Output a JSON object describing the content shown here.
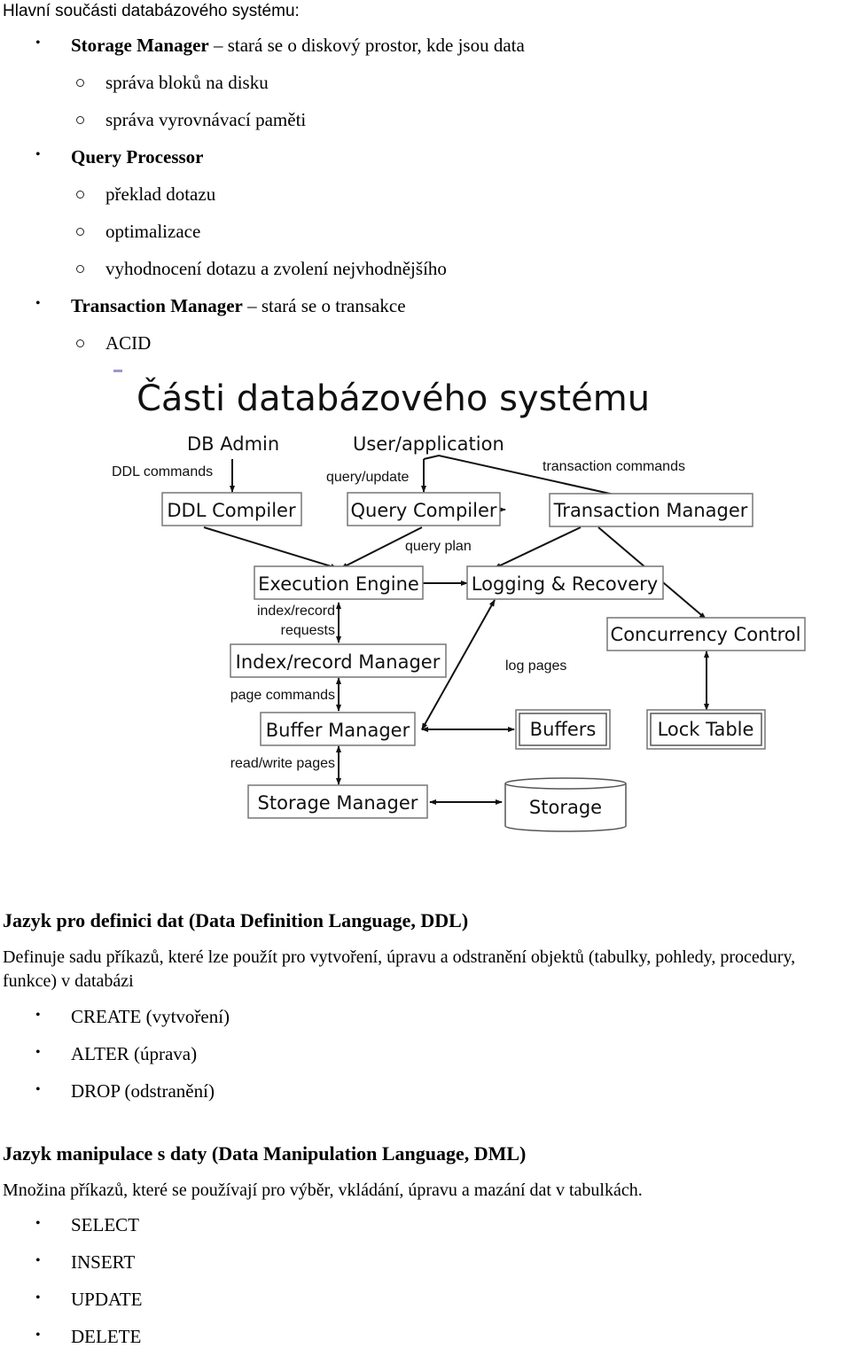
{
  "intro": "Hlavní součásti databázového systému:",
  "components": [
    {
      "name": "Storage Manager",
      "desc": " – stará se o diskový prostor, kde jsou data",
      "sub": [
        "správa bloků na disku",
        "správa vyrovnávací paměti"
      ]
    },
    {
      "name": "Query Processor",
      "desc": "",
      "sub": [
        "překlad dotazu",
        "optimalizace",
        "vyhodnocení dotazu a zvolení nejvhodnějšího"
      ]
    },
    {
      "name": "Transaction Manager",
      "desc": " – stará se o transakce",
      "sub": [
        "ACID"
      ]
    }
  ],
  "diagram": {
    "title": "Části databázového systému",
    "actors": {
      "db_admin": "DB Admin",
      "user_app": "User/application"
    },
    "boxes": {
      "ddl_compiler": "DDL Compiler",
      "query_compiler": "Query Compiler",
      "transaction_manager": "Transaction Manager",
      "execution_engine": "Execution Engine",
      "logging_recovery": "Logging & Recovery",
      "concurrency_control": "Concurrency Control",
      "index_record_manager": "Index/record Manager",
      "buffer_manager": "Buffer Manager",
      "buffers": "Buffers",
      "lock_table": "Lock Table",
      "storage_manager": "Storage Manager",
      "storage": "Storage"
    },
    "edge_labels": {
      "ddl_commands": "DDL commands",
      "query_update": "query/update",
      "transaction_commands": "transaction commands",
      "query_plan": "query plan",
      "index_record_requests_1": "index/record",
      "index_record_requests_2": "requests",
      "page_commands": "page commands",
      "read_write_pages": "read/write pages",
      "log_pages": "log pages"
    }
  },
  "ddl": {
    "heading": "Jazyk pro definici dat (Data Definition Language, DDL)",
    "paragraph": "Definuje sadu příkazů, které lze použít pro vytvoření, úpravu a odstranění objektů (tabulky, pohledy, procedury, funkce) v databázi",
    "items": [
      "CREATE (vytvoření)",
      "ALTER (úprava)",
      "DROP (odstranění)"
    ]
  },
  "dml": {
    "heading": "Jazyk manipulace s daty (Data Manipulation Language, DML)",
    "paragraph": "Množina příkazů, které se používají pro výběr, vkládání, úpravu a mazání dat v tabulkách.",
    "items": [
      "SELECT",
      "INSERT",
      "UPDATE",
      "DELETE"
    ]
  }
}
